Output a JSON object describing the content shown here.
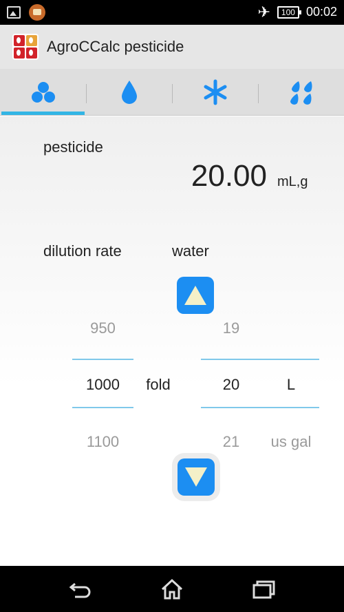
{
  "status_bar": {
    "battery": "100",
    "time": "00:02",
    "icons": [
      "image-icon",
      "app-notification-icon",
      "airplane-icon",
      "battery-icon"
    ]
  },
  "app": {
    "title": "AgroCCalc pesticide",
    "logo": "agroccalc-logo"
  },
  "tabs": [
    {
      "icon": "pesticide-dots-icon",
      "active": true
    },
    {
      "icon": "water-drop-icon",
      "active": false
    },
    {
      "icon": "asterisk-icon",
      "active": false
    },
    {
      "icon": "spray-drops-icon",
      "active": false
    }
  ],
  "main": {
    "pesticide_label": "pesticide",
    "amount": "20.00",
    "amount_unit": "mL,g",
    "dilution_label": "dilution rate",
    "water_label": "water",
    "dilution": {
      "prev": "950",
      "current": "1000",
      "next": "1100",
      "unit": "fold"
    },
    "water": {
      "prev": "19",
      "current": "20",
      "next": "21"
    },
    "water_unit": {
      "current": "L",
      "next": "us gal"
    }
  },
  "colors": {
    "accent": "#33b5e5",
    "icon_blue": "#1c8ef2",
    "button_arrow": "#f4f0c8"
  },
  "nav_bar": [
    "back-icon",
    "home-icon",
    "recent-apps-icon"
  ]
}
